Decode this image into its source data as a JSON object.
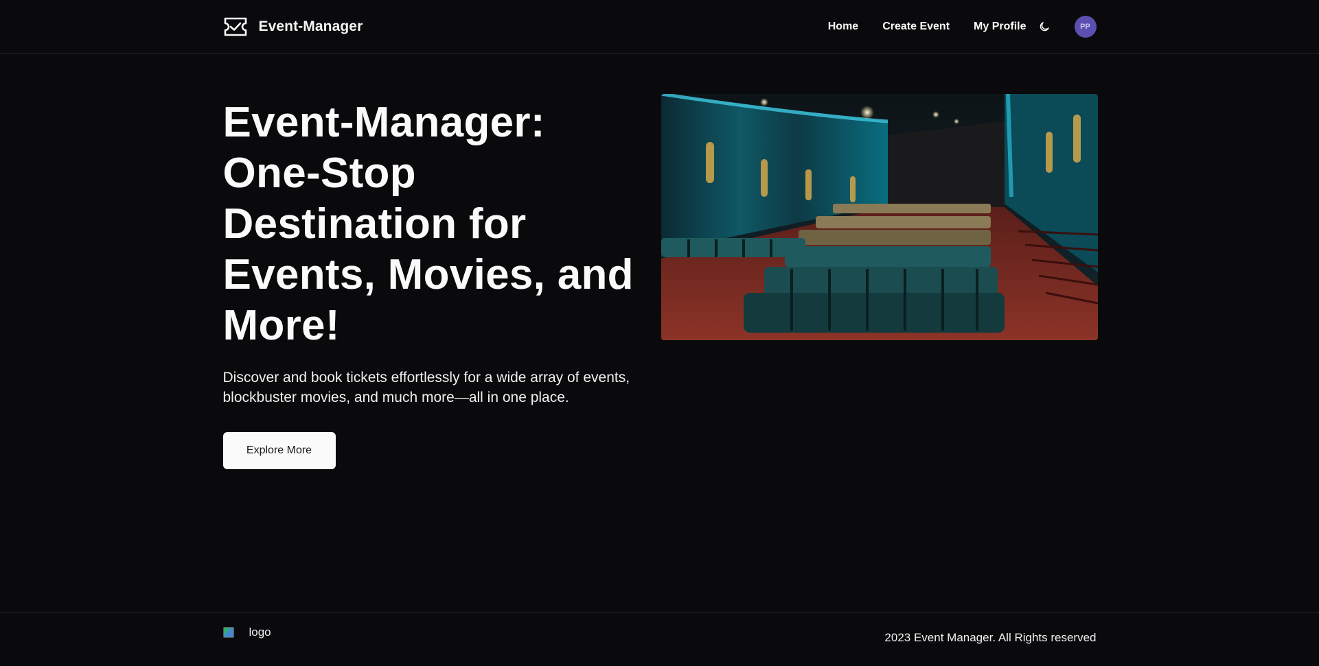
{
  "header": {
    "brand_name": "Event-Manager",
    "brand_icon": "ticket-check-icon",
    "nav": {
      "home": "Home",
      "create_event": "Create Event",
      "my_profile": "My Profile"
    },
    "theme_icon": "moon-icon",
    "avatar_initials": "PP",
    "avatar_color": "#5b4fb0"
  },
  "hero": {
    "title": "Event-Manager: One-Stop Destination for Events, Movies, and More!",
    "subtitle": "Discover and book tickets effortlessly for a wide array of events, blockbuster movies, and much more—all in one place.",
    "cta_label": "Explore More",
    "image_subject": "cinema-theater-seats"
  },
  "footer": {
    "logo_alt": "logo",
    "copyright": "2023 Event Manager. All Rights reserved"
  },
  "colors": {
    "background": "#0a0a0c",
    "text": "#fafafa",
    "button_bg": "#fafafa",
    "button_text": "#18181b",
    "border": "#27272a"
  }
}
